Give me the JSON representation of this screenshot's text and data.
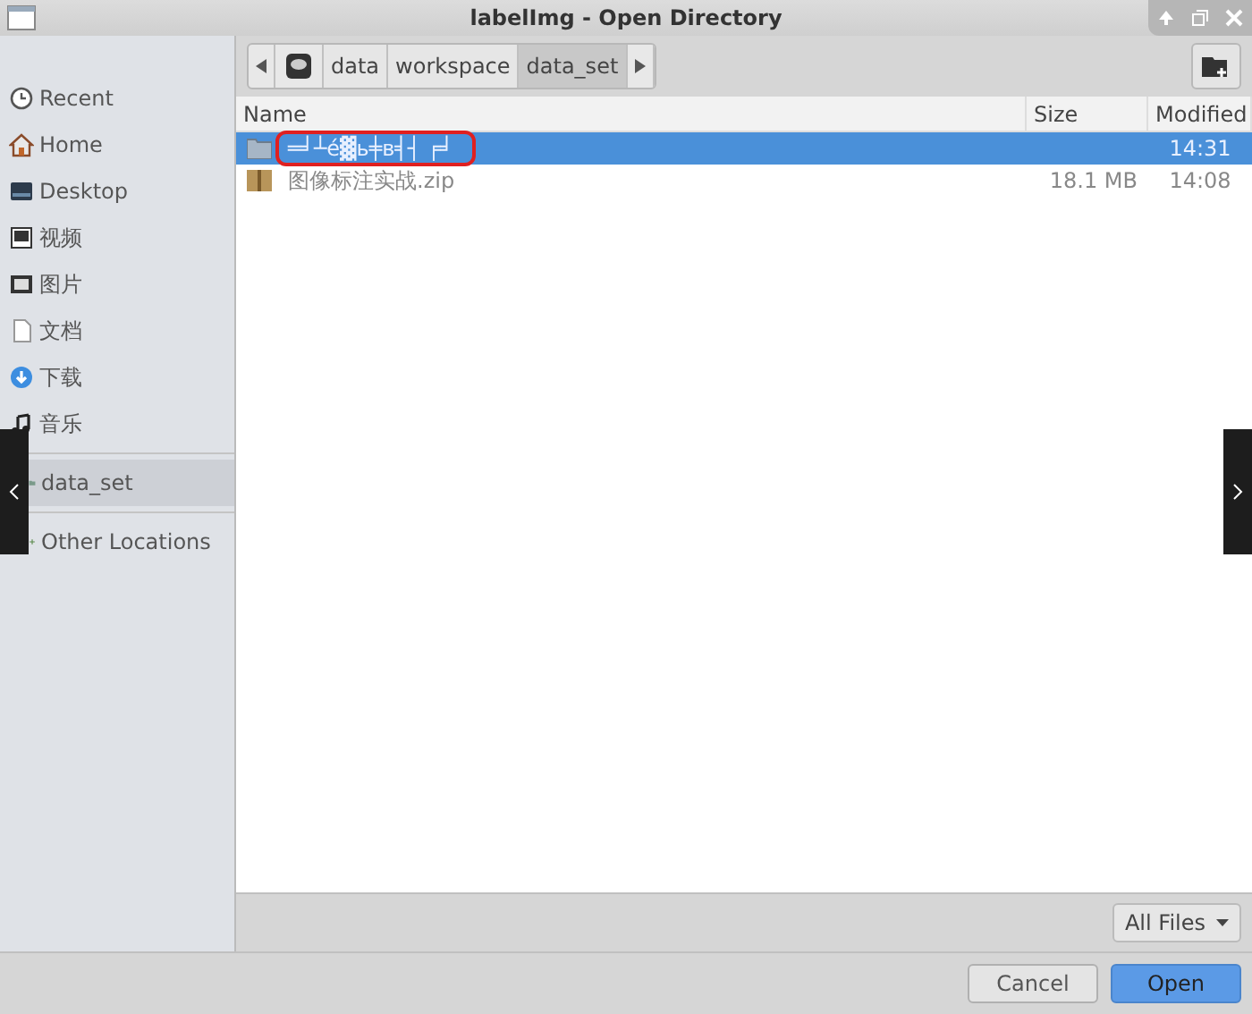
{
  "window": {
    "title": "labelImg - Open Directory"
  },
  "sidebar": {
    "items": [
      {
        "label": "Recent",
        "selected": false
      },
      {
        "label": "Home",
        "selected": false
      },
      {
        "label": "Desktop",
        "selected": false
      },
      {
        "label": "视频",
        "selected": false
      },
      {
        "label": "图片",
        "selected": false
      },
      {
        "label": "文档",
        "selected": false
      },
      {
        "label": "下载",
        "selected": false
      },
      {
        "label": "音乐",
        "selected": false
      },
      {
        "label": "data_set",
        "selected": true
      },
      {
        "label": "Other Locations",
        "selected": false
      }
    ]
  },
  "path_bar": {
    "segments": [
      {
        "label": "data",
        "selected": false
      },
      {
        "label": "workspace",
        "selected": false
      },
      {
        "label": "data_set",
        "selected": true
      }
    ]
  },
  "table": {
    "columns": [
      "Name",
      "Size",
      "Modified"
    ],
    "rows": [
      {
        "kind": "folder",
        "name": "═╛┴é▓ь╪в╡┤ ╒╛",
        "modified": "14:31",
        "selected": true,
        "highlighted": true
      },
      {
        "kind": "archive",
        "name": "图像标注实战.zip",
        "size": "18.1 MB",
        "modified": "14:08",
        "selected": false,
        "highlighted": false
      }
    ]
  },
  "filter": {
    "value": "All Files"
  },
  "buttons": [
    {
      "label": "Cancel",
      "kind": "normal"
    },
    {
      "label": "Open",
      "kind": "primary"
    }
  ]
}
